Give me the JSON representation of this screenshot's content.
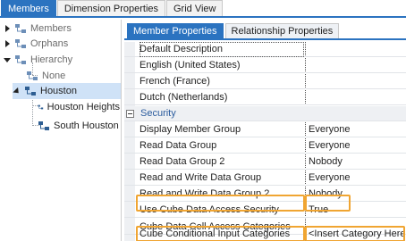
{
  "top_tabs": [
    "Members",
    "Dimension Properties",
    "Grid View"
  ],
  "tree": {
    "members": "Members",
    "orphans": "Orphans",
    "hierarchy": "Hierarchy",
    "none": "None",
    "houston": "Houston",
    "houston_heights": "Houston Heights",
    "south_houston": "South Houston"
  },
  "sub_tabs": [
    "Member Properties",
    "Relationship Properties"
  ],
  "rows": {
    "default_description": "Default Description",
    "english": "English (United States)",
    "french": "French (France)",
    "dutch": "Dutch (Netherlands)",
    "security_category": "Security",
    "display_member_group": {
      "name": "Display Member Group",
      "value": "Everyone"
    },
    "read_data_group": {
      "name": "Read Data Group",
      "value": "Everyone"
    },
    "read_data_group_2": {
      "name": "Read Data Group 2",
      "value": "Nobody"
    },
    "read_write_data_group": {
      "name": "Read and Write Data Group",
      "value": "Everyone"
    },
    "read_write_data_group_2": {
      "name": "Read and Write Data Group 2",
      "value": "Nobody"
    },
    "use_cube_security": {
      "name": "Use Cube Data Access Security",
      "value": "True"
    },
    "cube_cell_access": {
      "name": "Cube Data Cell Access Categories",
      "value": ""
    },
    "cube_conditional_input": {
      "name": "Cube Conditional Input Categories",
      "value": "<Insert Category Here>"
    }
  },
  "colors": {
    "accent": "#2b73c0",
    "highlight": "#f0a532",
    "selection": "#cfe2f7"
  }
}
